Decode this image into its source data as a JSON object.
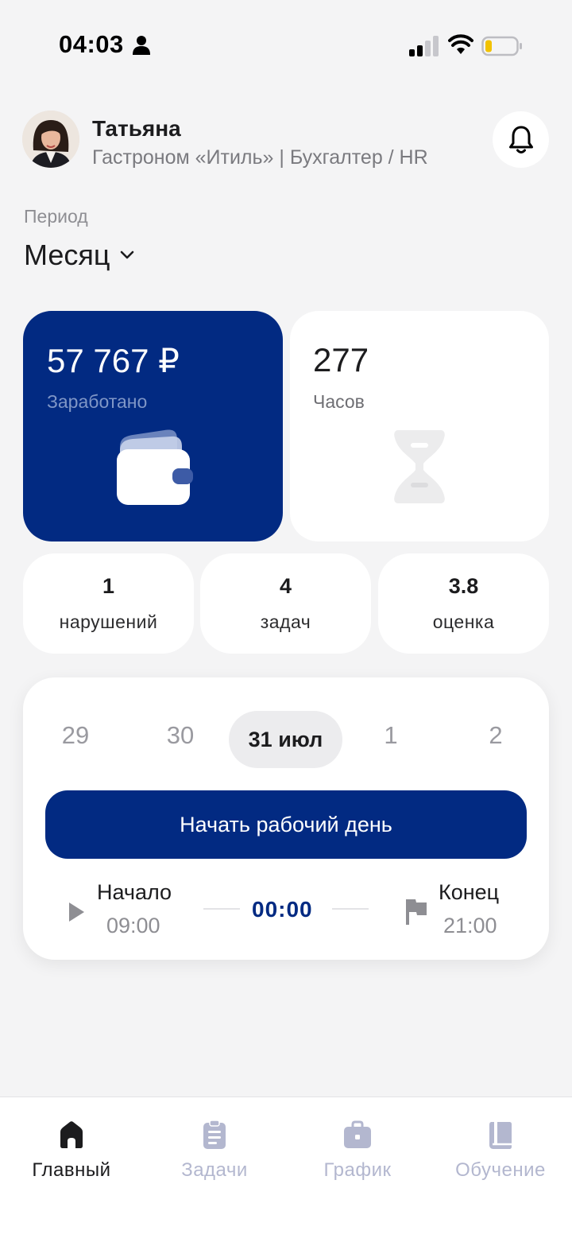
{
  "status_bar": {
    "time": "04:03"
  },
  "user": {
    "name": "Татьяна",
    "subtitle": "Гастроном «Итиль» | Бухгалтер / HR"
  },
  "period": {
    "label": "Период",
    "value": "Месяц"
  },
  "earned": {
    "value": "57 767 ₽",
    "label": "Заработано"
  },
  "hours": {
    "value": "277",
    "label": "Часов"
  },
  "stats": [
    {
      "value": "1",
      "label": "нарушений"
    },
    {
      "value": "4",
      "label": "задач"
    },
    {
      "value": "3.8",
      "label": "оценка"
    }
  ],
  "dates": {
    "items": [
      "29",
      "30",
      "31 июл",
      "1",
      "2"
    ],
    "active_index": 2
  },
  "workday": {
    "button_label": "Начать рабочий день",
    "start_label": "Начало",
    "start_time": "09:00",
    "timer": "00:00",
    "end_label": "Конец",
    "end_time": "21:00"
  },
  "nav": {
    "items": [
      {
        "label": "Главный",
        "icon": "home-icon",
        "active": true
      },
      {
        "label": "Задачи",
        "icon": "clipboard-icon",
        "active": false
      },
      {
        "label": "График",
        "icon": "briefcase-icon",
        "active": false
      },
      {
        "label": "Обучение",
        "icon": "book-icon",
        "active": false
      }
    ]
  },
  "colors": {
    "primary": "#022a82",
    "background": "#f4f4f5",
    "inactive_nav": "#b3b7cf"
  }
}
